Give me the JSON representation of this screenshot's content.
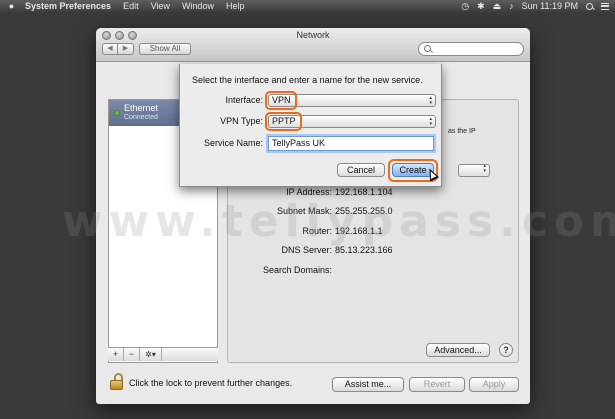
{
  "menubar": {
    "app": "System Preferences",
    "items": [
      "Edit",
      "View",
      "Window",
      "Help"
    ],
    "clock": "Sun 11:19 PM"
  },
  "window": {
    "title": "Network",
    "show_all": "Show All",
    "search_placeholder": ""
  },
  "sidebar": {
    "services": [
      {
        "name": "Ethernet",
        "status": "Connected",
        "status_color": "#5fc43a"
      }
    ],
    "add_label": "+",
    "remove_label": "−",
    "gear_label": "✲▾"
  },
  "pane": {
    "fragment_text": "as the IP",
    "info": [
      {
        "label": "IP Address:",
        "value": "192.168.1.104"
      },
      {
        "label": "Subnet Mask:",
        "value": "255.255.255.0"
      },
      {
        "label": "Router:",
        "value": "192.168.1.1"
      },
      {
        "label": "DNS Server:",
        "value": "85.13.223.166"
      },
      {
        "label": "Search Domains:",
        "value": ""
      }
    ],
    "advanced_label": "Advanced...",
    "help_label": "?"
  },
  "footer": {
    "lock_text": "Click the lock to prevent further changes.",
    "assist_label": "Assist me...",
    "revert_label": "Revert",
    "apply_label": "Apply"
  },
  "sheet": {
    "prompt": "Select the interface and enter a name for the new service.",
    "interface_label": "Interface:",
    "interface_value": "VPN",
    "vpn_type_label": "VPN Type:",
    "vpn_type_value": "PPTP",
    "service_name_label": "Service Name:",
    "service_name_value": "TellyPass UK",
    "cancel_label": "Cancel",
    "create_label": "Create",
    "highlight_color": "#ec6a1c"
  },
  "watermark": "www.tellypass.com"
}
